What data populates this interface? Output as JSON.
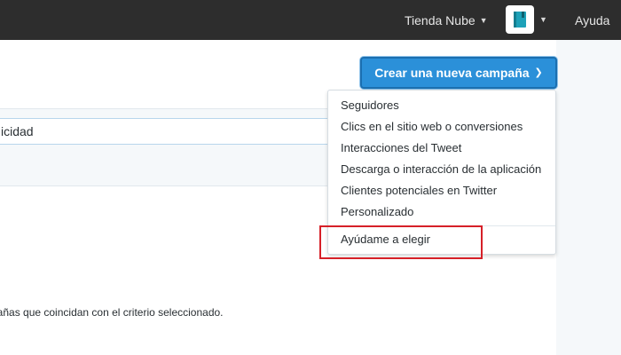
{
  "topbar": {
    "account_name": "Tienda Nube",
    "help_label": "Ayuda",
    "avatar_icon": "book-icon",
    "avatar_color": "#1da1b8"
  },
  "filter": {
    "field_text": "icidad"
  },
  "empty_state": {
    "text": "pañas que coincidan con el criterio seleccionado."
  },
  "create_button": {
    "label": "Crear una nueva campaña",
    "color": "#2b90d9"
  },
  "dropdown": {
    "items": [
      "Seguidores",
      "Clics en el sitio web o conversiones",
      "Interacciones del Tweet",
      "Descarga o interacción de la aplicación",
      "Clientes potenciales en Twitter",
      "Personalizado"
    ],
    "help_item": "Ayúdame a elegir"
  },
  "highlight_color": "#d62028"
}
